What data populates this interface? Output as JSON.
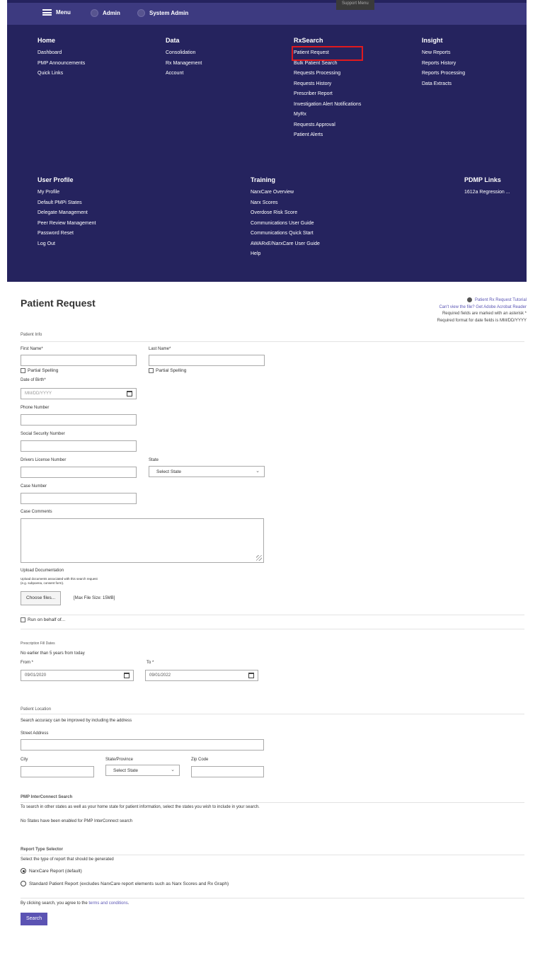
{
  "topbar": {
    "menu_label": "Menu",
    "role_admin": "Admin",
    "role_system_admin": "System Admin",
    "support_menu": "Support Menu"
  },
  "nav": {
    "home": {
      "title": "Home",
      "items": [
        "Dashboard",
        "PMP Announcements",
        "Quick Links"
      ]
    },
    "data": {
      "title": "Data",
      "items": [
        "Consolidation",
        "Rx Management",
        "Account"
      ]
    },
    "rxsearch": {
      "title": "RxSearch",
      "items": [
        "Patient Request",
        "Bulk Patient Search",
        "Requests Processing",
        "Requests History",
        "Prescriber Report",
        "Investigation Alert Notifications",
        "MyRx",
        "Requests Approval",
        "Patient Alerts"
      ]
    },
    "insight": {
      "title": "Insight",
      "items": [
        "New Reports",
        "Reports History",
        "Reports Processing",
        "Data Extracts"
      ]
    },
    "user_profile": {
      "title": "User Profile",
      "items": [
        "My Profile",
        "Default PMPi States",
        "Delegate Management",
        "Peer Review Management",
        "Password Reset",
        "Log Out"
      ]
    },
    "training": {
      "title": "Training",
      "items": [
        "NarxCare Overview",
        "Narx Scores",
        "Overdose Risk Score",
        "Communications User Guide",
        "Communications Quick Start",
        "AWARxE/NarxCare User Guide",
        "Help"
      ]
    },
    "pdmp_links": {
      "title": "PDMP Links",
      "items": [
        "1612a Regression ..."
      ]
    }
  },
  "form": {
    "title": "Patient Request",
    "tutorial": "Patient Rx Request Tutorial",
    "acrobat": "Can't view the file? Get Adobe Acrobat Reader",
    "required_note": "Required fields are marked with an asterisk *",
    "date_format_note": "Required format for date fields is MM/DD/YYYY",
    "patient_info": "Patient Info",
    "first_name_label": "First Name*",
    "last_name_label": "Last Name*",
    "partial_spelling": "Partial Spelling",
    "dob_label": "Date of Birth*",
    "dob_placeholder": "MM/DD/YYYY",
    "phone_label": "Phone Number",
    "ssn_label": "Social Security Number",
    "dl_label": "Drivers License Number",
    "state_label": "State",
    "state_select": "Select State",
    "case_number_label": "Case Number",
    "case_comments_label": "Case Comments",
    "upload_label": "Upload Documentation",
    "upload_help_1": "Upload documents associated with this search request",
    "upload_help_2": "(e.g. subpoena, consent form).",
    "choose_files": "Choose files...",
    "max_size": "[Max File Size: 15MB]",
    "run_on_behalf": "Run on behalf of...",
    "fill_dates_title": "Prescription Fill Dates",
    "fill_dates_note": "No earlier than 5 years from today",
    "from_label": "From *",
    "to_label": "To *",
    "from_value": "09/01/2020",
    "to_value": "09/01/2022",
    "patient_location": "Patient Location",
    "location_note": "Search accuracy can be improved by including the address",
    "street_label": "Street Address",
    "city_label": "City",
    "state_province_label": "State/Province",
    "zip_label": "Zip Code",
    "interconnect_title": "PMP InterConnect Search",
    "interconnect_note": "To search in other states as well as your home state for patient information, select the states you wish to include in your search.",
    "interconnect_none": "No States have been enabled for PMP InterConnect search",
    "report_type_title": "Report Type Selector",
    "report_type_note": "Select the type of report that should be generated",
    "report_narxcare": "NarxCare Report (default)",
    "report_standard": "Standard Patient Report (excludes NarxCare report elements such as Narx Scores and Rx Graph)",
    "agree_prefix": "By clicking search, you agree to the",
    "terms_link": "terms and conditions",
    "agree_suffix": ".",
    "search_button": "Search"
  }
}
